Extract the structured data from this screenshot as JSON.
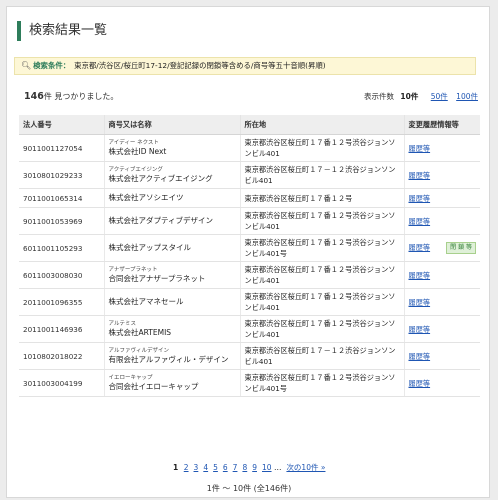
{
  "page": {
    "title": "検索結果一覧",
    "conditions_label": "検索条件：",
    "conditions_text": "東京都/渋谷区/桜丘町17-12/登記記録の閉鎖等含める/商号等五十音順(昇順)",
    "count_number": "146",
    "count_text": "件 見つかりました。",
    "perpage_label": "表示件数",
    "perpage_current": "10件",
    "perpage_50": "50件",
    "perpage_100": "100件"
  },
  "table": {
    "headers": [
      "法人番号",
      "商号又は名称",
      "所在地",
      "変更履歴情報等"
    ],
    "rows": [
      {
        "number": "9011001127054",
        "kana": "アイディー ネクスト",
        "name": "株式会社ID Next",
        "address": "東京都渋谷区桜丘町１７番１２号渋谷ジョンソンビル401",
        "history": "履歴等",
        "badge": ""
      },
      {
        "number": "3010801029233",
        "kana": "アクティブエイジング",
        "name": "株式会社アクティブエイジング",
        "address": "東京都渋谷区桜丘町１７－１２渋谷ジョンソンビル401",
        "history": "履歴等",
        "badge": ""
      },
      {
        "number": "7011001065314",
        "kana": "",
        "name": "株式会社アソシエイツ",
        "address": "東京都渋谷区桜丘町１７番１２号",
        "history": "履歴等",
        "badge": ""
      },
      {
        "number": "9011001053969",
        "kana": "",
        "name": "株式会社アダプティブデザイン",
        "address": "東京都渋谷区桜丘町１７番１２号渋谷ジョンソンビル401",
        "history": "履歴等",
        "badge": ""
      },
      {
        "number": "6011001105293",
        "kana": "",
        "name": "株式会社アップスタイル",
        "address": "東京都渋谷区桜丘町１７番１２号渋谷ジョンソンビル401号",
        "history": "履歴等",
        "badge": "閉 鎖 等"
      },
      {
        "number": "6011003008030",
        "kana": "アナザープラネット",
        "name": "合同会社アナザープラネット",
        "address": "東京都渋谷区桜丘町１７番１２号渋谷ジョンソンビル401",
        "history": "履歴等",
        "badge": ""
      },
      {
        "number": "2011001096355",
        "kana": "",
        "name": "株式会社アマネセール",
        "address": "東京都渋谷区桜丘町１７番１２号渋谷ジョンソンビル401",
        "history": "履歴等",
        "badge": ""
      },
      {
        "number": "2011001146936",
        "kana": "アルテミス",
        "name": "株式会社ARTEMIS",
        "address": "東京都渋谷区桜丘町１７番１２号渋谷ジョンソンビル401",
        "history": "履歴等",
        "badge": ""
      },
      {
        "number": "1010802018022",
        "kana": "アルファヴィルデザイン",
        "name": "有限会社アルファヴィル・デザイン",
        "address": "東京都渋谷区桜丘町１７－１２渋谷ジョンソンビル401",
        "history": "履歴等",
        "badge": ""
      },
      {
        "number": "3011003004199",
        "kana": "イエローキャップ",
        "name": "合同会社イエローキャップ",
        "address": "東京都渋谷区桜丘町１７番１２号渋谷ジョンソンビル401号",
        "history": "履歴等",
        "badge": ""
      }
    ]
  },
  "pager": {
    "current": "1",
    "pages": [
      "2",
      "3",
      "4",
      "5",
      "6",
      "7",
      "8",
      "9",
      "10"
    ],
    "ellipsis": "…",
    "next": "次の10件 »",
    "range": "1件 ～ 10件 (全146件)"
  }
}
